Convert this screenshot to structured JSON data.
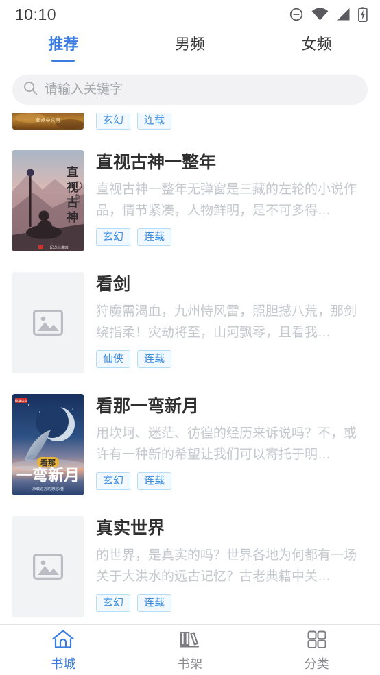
{
  "status_bar": {
    "time": "10:10",
    "icons": [
      "do-not-disturb-icon",
      "wifi-icon",
      "signal-icon",
      "battery-charging-icon"
    ]
  },
  "tabs": [
    {
      "label": "推荐",
      "active": true
    },
    {
      "label": "男频",
      "active": false
    },
    {
      "label": "女频",
      "active": false
    }
  ],
  "search": {
    "placeholder": "请输入关键字",
    "value": "",
    "icon": "search-icon"
  },
  "colors": {
    "accent": "#3b7ce0",
    "tag_text": "#3b8de0",
    "tag_border": "#b7dcf5",
    "tag_bg": "#f2f9fe",
    "title": "#303030",
    "desc": "#c5c8ce",
    "search_bg": "#f2f2f4"
  },
  "books": [
    {
      "title": "",
      "desc": "",
      "tags": [
        "玄幻",
        "连载"
      ],
      "cover_type": "image-brown",
      "cover_watermark": "起点中文网",
      "clipped": true
    },
    {
      "title": "直视古神一整年",
      "desc": "直视古神一整年无弹窗是三藏的左轮的小说作品，情节紧凑，人物鲜明，是不可多得…",
      "tags": [
        "玄幻",
        "连载"
      ],
      "cover_type": "image-rider",
      "cover_watermark": "起点小说网",
      "clipped": false
    },
    {
      "title": "看剑",
      "desc": "狩魔需渴血，九州恃风雷，照胆撼八荒，那剑绕指柔！灾劫将至，山河飘零，且看我…",
      "tags": [
        "仙侠",
        "连载"
      ],
      "cover_type": "placeholder",
      "cover_watermark": "",
      "clipped": false
    },
    {
      "title": "看那一弯新月",
      "desc": "用坎坷、迷茫、彷徨的经历来诉说吗？不，或许有一种新的希望让我们可以寄托于明…",
      "tags": [
        "玄幻",
        "连载"
      ],
      "cover_type": "image-moon",
      "cover_watermark": "",
      "clipped": false
    },
    {
      "title": "真实世界",
      "desc": "的世界，是真实的吗？世界各地为何都有一场关于大洪水的远古记忆？古老典籍中关…",
      "tags": [
        "玄幻",
        "连载"
      ],
      "cover_type": "placeholder",
      "cover_watermark": "",
      "clipped": false
    }
  ],
  "bottom_nav": [
    {
      "label": "书城",
      "icon": "home-icon",
      "active": true
    },
    {
      "label": "书架",
      "icon": "bookshelf-icon",
      "active": false
    },
    {
      "label": "分类",
      "icon": "grid-icon",
      "active": false
    }
  ]
}
